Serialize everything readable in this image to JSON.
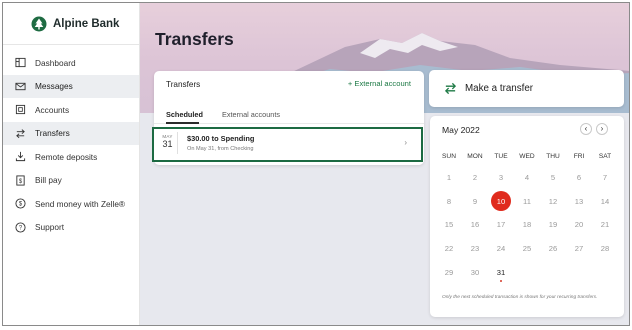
{
  "brand": {
    "name": "Alpine Bank",
    "logo_icon": "tree-icon",
    "color": "#1e7a46"
  },
  "sidebar": {
    "items": [
      {
        "label": "Dashboard",
        "icon": "dashboard-icon"
      },
      {
        "label": "Messages",
        "icon": "envelope-icon"
      },
      {
        "label": "Accounts",
        "icon": "accounts-icon"
      },
      {
        "label": "Transfers",
        "icon": "transfer-arrows-icon",
        "active": true
      },
      {
        "label": "Remote deposits",
        "icon": "deposit-icon"
      },
      {
        "label": "Bill pay",
        "icon": "dollar-doc-icon"
      },
      {
        "label": "Send money with Zelle®",
        "icon": "dollar-circle-icon"
      },
      {
        "label": "Support",
        "icon": "question-icon"
      }
    ]
  },
  "page": {
    "title": "Transfers"
  },
  "transfers_card": {
    "title": "Transfers",
    "external_link": "+ External account",
    "tabs": [
      "Scheduled",
      "External accounts"
    ],
    "selected_tab": "Scheduled",
    "row": {
      "month": "MAY",
      "day": "31",
      "title": "$30.00 to Spending",
      "subtitle": "On May 31, from Checking"
    }
  },
  "make_transfer": {
    "label": "Make a transfer"
  },
  "calendar": {
    "month": "May 2022",
    "prev_icon": "chevron-left-icon",
    "next_icon": "chevron-right-icon",
    "weekdays": [
      "SUN",
      "MON",
      "TUE",
      "WED",
      "THU",
      "FRI",
      "SAT"
    ],
    "weeks": [
      [
        "1",
        "2",
        "3",
        "4",
        "5",
        "6",
        "7"
      ],
      [
        "8",
        "9",
        "10",
        "11",
        "12",
        "13",
        "14"
      ],
      [
        "15",
        "16",
        "17",
        "18",
        "19",
        "20",
        "21"
      ],
      [
        "22",
        "23",
        "24",
        "25",
        "26",
        "27",
        "28"
      ],
      [
        "29",
        "30",
        "31",
        "",
        "",
        "",
        ""
      ]
    ],
    "today": "10",
    "scheduled_day": "31",
    "note": "Only the next scheduled transaction is shown for your recurring transfers."
  },
  "colors": {
    "today": "#e02b1d",
    "highlight_border": "#1c6a42"
  }
}
